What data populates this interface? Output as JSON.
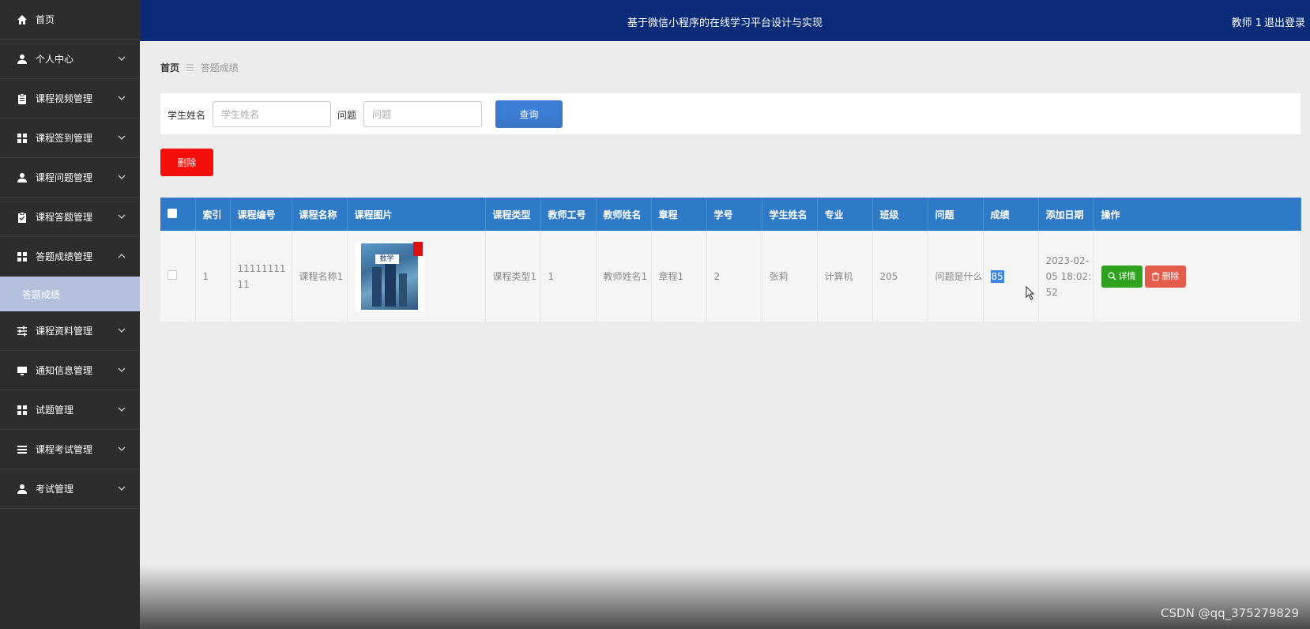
{
  "sidebar": {
    "items": [
      {
        "label": "首页",
        "icon": "home-icon",
        "chevron": false
      },
      {
        "label": "个人中心",
        "icon": "user-icon",
        "chevron": true
      },
      {
        "label": "课程视频管理",
        "icon": "clipboard-icon",
        "chevron": true
      },
      {
        "label": "课程签到管理",
        "icon": "grid-icon",
        "chevron": true
      },
      {
        "label": "课程问题管理",
        "icon": "user-icon",
        "chevron": true
      },
      {
        "label": "课程答题管理",
        "icon": "clipboard-check-icon",
        "chevron": true
      },
      {
        "label": "答题成绩管理",
        "icon": "grid-icon",
        "chevron": true,
        "expanded": true
      },
      {
        "label": "课程资料管理",
        "icon": "sliders-icon",
        "chevron": true
      },
      {
        "label": "通知信息管理",
        "icon": "monitor-icon",
        "chevron": true
      },
      {
        "label": "试题管理",
        "icon": "grid-icon",
        "chevron": true
      },
      {
        "label": "课程考试管理",
        "icon": "list-icon",
        "chevron": true
      },
      {
        "label": "考试管理",
        "icon": "user-icon",
        "chevron": true
      }
    ],
    "sub_item": "答题成绩"
  },
  "header": {
    "title": "基于微信小程序的在线学习平台设计与实现",
    "user": "教师 1",
    "logout": "退出登录"
  },
  "breadcrumb": {
    "home": "首页",
    "current": "答题成绩"
  },
  "search": {
    "student_label": "学生姓名",
    "student_placeholder": "学生姓名",
    "question_label": "问题",
    "question_placeholder": "问题",
    "query_button": "查询"
  },
  "delete_button": "删除",
  "table": {
    "headers": [
      "索引",
      "课程编号",
      "课程名称",
      "课程图片",
      "课程类型",
      "教师工号",
      "教师姓名",
      "章程",
      "学号",
      "学生姓名",
      "专业",
      "班级",
      "问题",
      "成绩",
      "添加日期",
      "操作"
    ],
    "rows": [
      {
        "index": "1",
        "course_no": "1111111111",
        "course_name": "课程名称1",
        "course_type": "课程类型1",
        "teacher_no": "1",
        "teacher_name": "教师姓名1",
        "chapter": "章程1",
        "student_no": "2",
        "student_name": "张莉",
        "major": "计算机",
        "class": "205",
        "question": "问题是什么",
        "score": "85",
        "date": "2023-02-05 18:02:52",
        "detail_label": "详情",
        "delete_label": "删除",
        "book_title": "数学"
      }
    ]
  },
  "watermark": "CSDN @qq_375279829",
  "colors": {
    "sidebar": "#2d2d2d",
    "header": "#0a2c78",
    "table_header": "#2f7ac6",
    "query_button": "#3d7fd6",
    "delete_button": "#f50f0a",
    "detail_button": "#2ea11e",
    "row_delete_button": "#e45c4b"
  }
}
